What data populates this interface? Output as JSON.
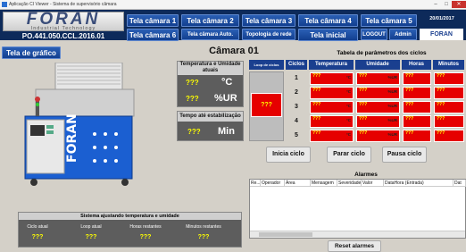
{
  "window": {
    "title": "Aplicação CI Viewer - Sistema de supervisório câmara"
  },
  "header": {
    "logo": "FORAN",
    "logo_sub": "Industrial Technology",
    "serial": "PO.441.050.CCL.2016.01",
    "nav_row1": [
      "Tela câmara 1",
      "Tela câmara 2",
      "Tela câmara 3",
      "Tela câmara 4",
      "Tela câmara 5"
    ],
    "nav_row2": [
      "Tela câmara 6",
      "Tela câmara Auto.",
      "Topologia de rede",
      "Tela inicial",
      "LOGOUT",
      "Admin"
    ],
    "datetime": "20/01/2017 09:20:18",
    "brand_button": "FORAN"
  },
  "graph_button": "Tela de gráfico",
  "chamber": {
    "title": "Câmara 01",
    "temp_humidity_label": "Temperatura e Umidade atuais",
    "temp_value": "???",
    "temp_unit": "°C",
    "humidity_value": "???",
    "humidity_unit": "%UR",
    "stabilization_label": "Tempo até estabilização",
    "stabilization_value": "???",
    "stabilization_unit": "Min"
  },
  "cycle_table": {
    "title": "Tabela de parâmetros dos ciclos",
    "header_cycle": "Loop de ciclos",
    "columns": [
      "Ciclos",
      "Temperatura",
      "Umidade",
      "Horas",
      "Minutos"
    ],
    "loop_value": "???",
    "rows": [
      {
        "n": "1",
        "temp": "???",
        "temp_unit": "°C",
        "hum": "???",
        "hum_unit": "%UR",
        "hours": "???",
        "minutes": "???"
      },
      {
        "n": "2",
        "temp": "???",
        "temp_unit": "°C",
        "hum": "???",
        "hum_unit": "%UR",
        "hours": "???",
        "minutes": "???"
      },
      {
        "n": "3",
        "temp": "???",
        "temp_unit": "°C",
        "hum": "???",
        "hum_unit": "%UR",
        "hours": "???",
        "minutes": "???"
      },
      {
        "n": "4",
        "temp": "???",
        "temp_unit": "°C",
        "hum": "???",
        "hum_unit": "%UR",
        "hours": "???",
        "minutes": "???"
      },
      {
        "n": "5",
        "temp": "???",
        "temp_unit": "°C",
        "hum": "???",
        "hum_unit": "%UR",
        "hours": "???",
        "minutes": "???"
      }
    ]
  },
  "actions": {
    "start": "Inicia ciclo",
    "stop": "Parar ciclo",
    "pause": "Pausa ciclo"
  },
  "alarms": {
    "title": "Alarmes",
    "columns": [
      "Re...",
      "Operador",
      "Área",
      "Mensagem",
      "Severidade",
      "Valor",
      "DataHora (Entrada)",
      "Dat"
    ],
    "reset": "Reset alarmes"
  },
  "status_panel": {
    "title": "Sistema ajustando temperatura e umidade",
    "labels": [
      "Ciclo atual",
      "Loop atual",
      "Horas restantes",
      "Minutos restantes"
    ],
    "values": [
      "???",
      "???",
      "???",
      "???"
    ]
  },
  "colors": {
    "header": "#0d2a5a",
    "nav": "#1a4a9f",
    "alarm_red": "#e60000",
    "value_yellow": "#ffff00"
  }
}
